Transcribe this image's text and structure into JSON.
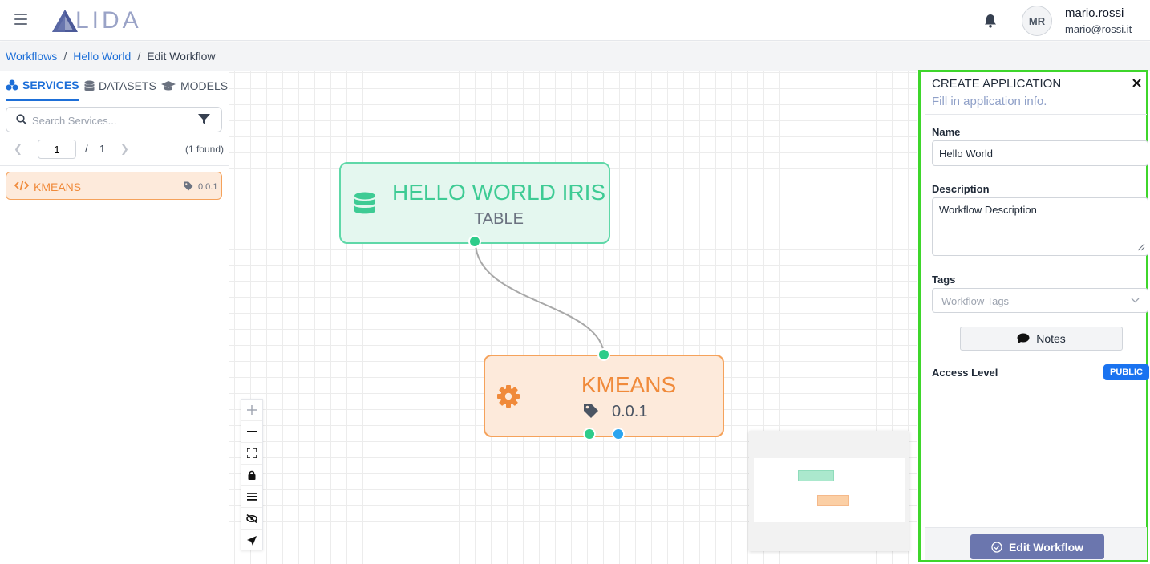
{
  "app": {
    "logo_text": "LIDA"
  },
  "user": {
    "initials": "MR",
    "name": "mario.rossi",
    "email": "mario@rossi.it"
  },
  "breadcrumb": {
    "items": [
      "Workflows",
      "Hello World"
    ],
    "current": "Edit Workflow",
    "separator": "/"
  },
  "sidebar": {
    "tabs": [
      {
        "label": "SERVICES",
        "icon": "services-icon",
        "active": true
      },
      {
        "label": "DATASETS",
        "icon": "database-icon",
        "active": false
      },
      {
        "label": "MODELS",
        "icon": "graduation-cap-icon",
        "active": false
      }
    ],
    "search_placeholder": "Search Services...",
    "pager": {
      "page": "1",
      "slash": "/",
      "total": "1",
      "found": "(1 found)"
    },
    "items": [
      {
        "label": "KMEANS",
        "version": "0.0.1"
      }
    ]
  },
  "canvas": {
    "nodes": [
      {
        "title": "HELLO WORLD IRIS",
        "subtitle": "TABLE",
        "icon": "database-icon",
        "color": "#3ecb94"
      },
      {
        "title": "KMEANS",
        "version": "0.0.1",
        "icon": "gear-icon",
        "color": "#f08a3a"
      }
    ]
  },
  "panel": {
    "title": "CREATE APPLICATION",
    "subtitle": "Fill in application info.",
    "name_label": "Name",
    "name_value": "Hello World",
    "description_label": "Description",
    "description_value": "Workflow Description",
    "tags_label": "Tags",
    "tags_placeholder": "Workflow Tags",
    "notes_label": "Notes",
    "access_label": "Access Level",
    "access_value": "PUBLIC",
    "submit_label": "Edit Workflow"
  },
  "colors": {
    "accent": "#1d6fd8",
    "panel_border": "#3ed62b",
    "submit": "#6b76ae"
  }
}
